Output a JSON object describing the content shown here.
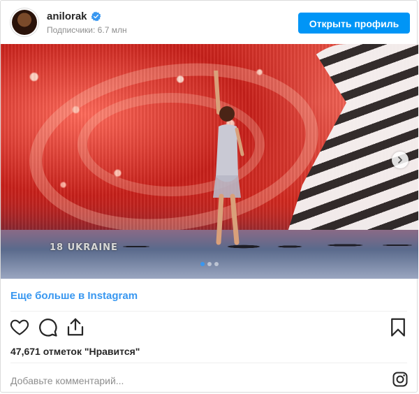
{
  "header": {
    "username": "anilorak",
    "followers_text": "Подписчики: 6.7 млн",
    "open_profile_label": "Открыть профиль"
  },
  "media": {
    "overlay_caption": "18  UKRAINE",
    "carousel": {
      "slides": 3,
      "active_index": 0
    }
  },
  "more_link": "Еще больше в Instagram",
  "likes_text": "47,671 отметок \"Нравится\"",
  "comment": {
    "placeholder": "Добавьте комментарий..."
  },
  "colors": {
    "accent": "#3897f0",
    "button": "#0095f6",
    "text": "#262626",
    "muted": "#8e8e8e"
  },
  "icons": [
    "verified-icon",
    "heart-icon",
    "comment-icon",
    "share-icon",
    "bookmark-icon",
    "instagram-logo-icon",
    "chevron-right-icon"
  ]
}
